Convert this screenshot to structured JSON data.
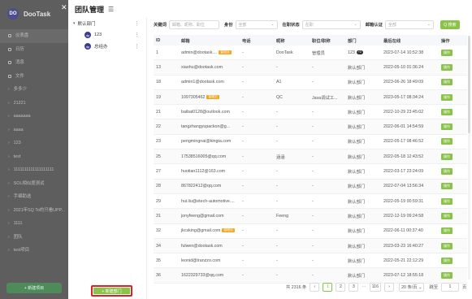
{
  "background_app": {
    "brand": "DooTask",
    "logo_text": "DO",
    "close_icon": "close-icon",
    "nav": [
      {
        "label": "仪表盘",
        "type": "dot"
      },
      {
        "label": "日历",
        "type": "dot"
      },
      {
        "label": "消息",
        "type": "dot"
      },
      {
        "label": "文件",
        "type": "dot"
      },
      {
        "label": "多多少",
        "type": "chev"
      },
      {
        "label": "21221",
        "type": "chev"
      },
      {
        "label": "aaaaaaa",
        "type": "chev"
      },
      {
        "label": "aaaa",
        "type": "chev"
      },
      {
        "label": "123",
        "type": "chev"
      },
      {
        "label": "test",
        "type": "chev"
      },
      {
        "label": "1111111111111111111",
        "type": "chev"
      },
      {
        "label": "SOL相似度测试",
        "type": "chev"
      },
      {
        "label": "手编助选",
        "type": "chev"
      },
      {
        "label": "2021年SQ To的只看UPP...",
        "type": "chev"
      },
      {
        "label": "1111",
        "type": "chev"
      },
      {
        "label": "团队",
        "type": "chev"
      },
      {
        "label": "test项目",
        "type": "chev"
      }
    ],
    "bottom_button": "+ 新建项目"
  },
  "panel": {
    "title": "团队管理",
    "title_icon": "list-icon"
  },
  "departments": {
    "root": {
      "label": "默认部门",
      "more": "⋮"
    },
    "children": [
      {
        "label": "123",
        "avatar": "dp",
        "more": "⋮"
      },
      {
        "label": "总经办",
        "avatar": "dp",
        "more": "⋮"
      }
    ],
    "new_button": "+ 新建部门"
  },
  "filters": {
    "keyword_label": "关键词",
    "keyword_placeholder": "邮箱、昵称、职位",
    "identity_label": "身份",
    "identity_value": "全部",
    "status_label": "在职状态",
    "status_value": "在职",
    "email_label": "邮箱认证",
    "email_value": "全部",
    "search_button": "Q 搜索"
  },
  "table": {
    "headers": [
      "ID",
      "邮箱",
      "电话",
      "昵称",
      "职位/职称",
      "部门",
      "最后在线",
      "操作"
    ],
    "rows": [
      {
        "id": "1",
        "email": "admin@dootask....",
        "badge": "管理员",
        "badge2": "",
        "phone": "-",
        "nick": "DooTask",
        "pos": "管理员",
        "dept": "123",
        "dept_count": "+2",
        "online": "2023-07-14 10:52:38",
        "op": "操作"
      },
      {
        "id": "13",
        "email": "xiaohu@dootask.com",
        "badge": "",
        "badge2": "",
        "phone": "-",
        "nick": "-",
        "pos": "-",
        "dept": "默认部门",
        "dept_count": "",
        "online": "2022-05-10 01:36:24",
        "op": "操作"
      },
      {
        "id": "18",
        "email": "admin1@dootask.com",
        "badge": "",
        "badge2": "",
        "phone": "-",
        "nick": "A1",
        "pos": "-",
        "dept": "默认部门",
        "dept_count": "",
        "online": "2023-06-26 18:49:09",
        "op": "操作"
      },
      {
        "id": "19",
        "email": "1097305462",
        "badge": "管理员",
        "badge2": "",
        "phone": "-",
        "nick": "QC",
        "pos": "Java调试工...",
        "dept": "默认部门",
        "dept_count": "",
        "online": "2023-05-17 08:34:24",
        "op": "操作"
      },
      {
        "id": "21",
        "email": "baibai0128@outlook.com",
        "badge": "",
        "badge2": "",
        "phone": "-",
        "nick": "-",
        "pos": "-",
        "dept": "默认部门",
        "dept_count": "",
        "online": "2022-10-29 23:45:02",
        "op": "操作"
      },
      {
        "id": "22",
        "email": "tangzhangyupackon@g...",
        "badge": "",
        "badge2": "",
        "phone": "-",
        "nick": "-",
        "pos": "-",
        "dept": "默认部门",
        "dept_count": "",
        "online": "2022-06-01 14:54:59",
        "op": "操作"
      },
      {
        "id": "23",
        "email": "pengmingnai@kingta.com",
        "badge": "",
        "badge2": "",
        "phone": "-",
        "nick": "-",
        "pos": "-",
        "dept": "默认部门",
        "dept_count": "",
        "online": "2022-05-17 08:46:52",
        "op": "操作"
      },
      {
        "id": "25",
        "email": "17538516005@qq.com",
        "badge": "",
        "badge2": "",
        "phone": "-",
        "nick": "涵涵",
        "pos": "-",
        "dept": "默认部门",
        "dept_count": "",
        "online": "2022-05-18 12:43:52",
        "op": "操作"
      },
      {
        "id": "27",
        "email": "huotian1112@163.com",
        "badge": "",
        "badge2": "",
        "phone": "-",
        "nick": "-",
        "pos": "-",
        "dept": "默认部门",
        "dept_count": "",
        "online": "2022-03-17 23:24:09",
        "op": "操作"
      },
      {
        "id": "28",
        "email": "867822412@qq.com",
        "badge": "",
        "badge2": "",
        "phone": "-",
        "nick": "-",
        "pos": "-",
        "dept": "默认部门",
        "dept_count": "",
        "online": "2022-07-04 13:56:34",
        "op": "操作"
      },
      {
        "id": "29",
        "email": "hui.liu@etech-automotive....",
        "badge": "",
        "badge2": "",
        "phone": "-",
        "nick": "-",
        "pos": "-",
        "dept": "默认部门",
        "dept_count": "",
        "online": "2022-05-19 00:59:31",
        "op": "操作"
      },
      {
        "id": "31",
        "email": "jonyfeeng@gmail.com",
        "badge": "",
        "badge2": "",
        "phone": "-",
        "nick": "Feeng",
        "pos": "-",
        "dept": "默认部门",
        "dept_count": "",
        "online": "2022-12-19 09:24:58",
        "op": "操作"
      },
      {
        "id": "32",
        "email": "jkcsking@gmail.com",
        "badge": "管理员",
        "badge2": "",
        "phone": "-",
        "nick": "-",
        "pos": "-",
        "dept": "默认部门",
        "dept_count": "",
        "online": "2022-06-11 00:37:40",
        "op": "操作"
      },
      {
        "id": "34",
        "email": "fulwen@dootask.com",
        "badge": "",
        "badge2": "",
        "phone": "-",
        "nick": "-",
        "pos": "-",
        "dept": "默认部门",
        "dept_count": "",
        "online": "2023-03-23 16:40:27",
        "op": "操作"
      },
      {
        "id": "35",
        "email": "leonid@tranzzo.com",
        "badge": "",
        "badge2": "",
        "phone": "-",
        "nick": "-",
        "pos": "-",
        "dept": "默认部门",
        "dept_count": "",
        "online": "2022-05-21 22:12:29",
        "op": "操作"
      },
      {
        "id": "36",
        "email": "1622329733@qq.com",
        "badge": "",
        "badge2": "",
        "phone": "-",
        "nick": "-",
        "pos": "-",
        "dept": "默认部门",
        "dept_count": "",
        "online": "2023-07-12 18:55:18",
        "op": "操作"
      }
    ]
  },
  "pagination": {
    "total": "共 2316 条",
    "prev": "‹",
    "pages": [
      "1",
      "2",
      "3"
    ],
    "ellipsis": "···",
    "last": "116",
    "next": "›",
    "page_size": "20 条/页 ⌄",
    "goto_label": "跳至",
    "goto_value": "1",
    "page_word": "页"
  },
  "colors": {
    "accent": "#8bc34a",
    "highlight_border": "#e02020",
    "admin_badge": "#f5a623"
  }
}
